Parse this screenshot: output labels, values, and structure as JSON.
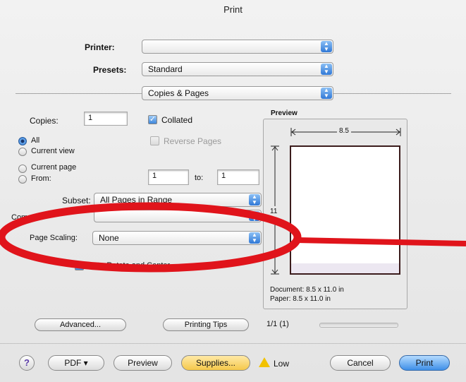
{
  "window": {
    "title": "Print"
  },
  "printer": {
    "label": "Printer:",
    "value": ""
  },
  "presets": {
    "label": "Presets:",
    "value": "Standard"
  },
  "pane": {
    "value": "Copies & Pages"
  },
  "copies": {
    "label": "Copies:",
    "value": "1",
    "collated_label": "Collated",
    "collated": true,
    "reverse_label": "Reverse Pages",
    "reverse": false
  },
  "pages": {
    "options": [
      "All",
      "Current view",
      "Current page",
      "From:"
    ],
    "selected": "All",
    "from_value": "1",
    "to_label": "to:",
    "to_value": "1"
  },
  "subset": {
    "label": "Subset:",
    "value": "All Pages in Range"
  },
  "comments": {
    "label": "Comme",
    "value": ""
  },
  "page_scaling": {
    "label": "Page Scaling:",
    "value": "None"
  },
  "auto_rotate": {
    "label": "Auto-Rotate and Center",
    "checked": true
  },
  "preview": {
    "heading": "Preview",
    "width_label": "8.5",
    "height_label": "11",
    "document": "Document: 8.5 x 11.0 in",
    "paper": "Paper: 8.5 x 11.0 in"
  },
  "mid_buttons": {
    "advanced": "Advanced...",
    "tips": "Printing Tips",
    "page_count": "1/1 (1)"
  },
  "bottom": {
    "help": "?",
    "pdf": "PDF ▾",
    "preview": "Preview",
    "supplies": "Supplies...",
    "low_label": "Low",
    "cancel": "Cancel",
    "print": "Print"
  },
  "colors": {
    "annotation": "#e0141b",
    "accent": "#3e8fe8",
    "warning": "#f2c200"
  }
}
